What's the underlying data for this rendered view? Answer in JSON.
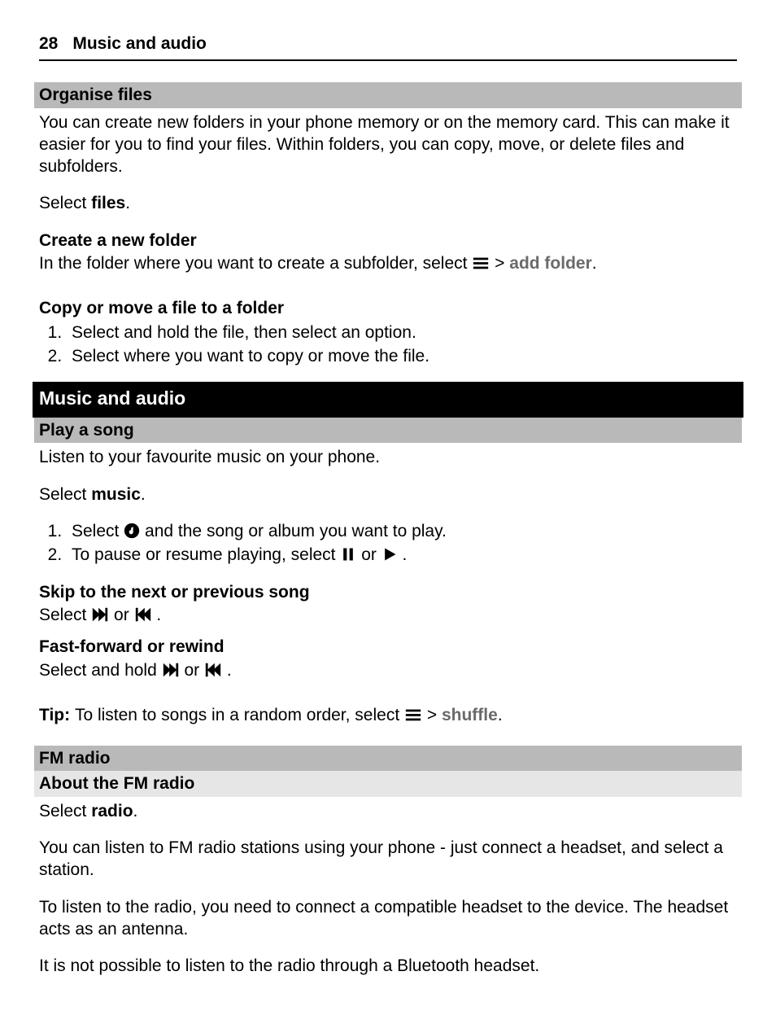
{
  "header": {
    "page_number": "28",
    "title": "Music and audio"
  },
  "sections": {
    "organise_files": {
      "heading": "Organise files",
      "p1": "You can create new folders in your phone memory or on the memory card. This can make it easier for you to find your files. Within folders, you can copy, move, or delete files and subfolders.",
      "select_prefix": "Select ",
      "select_word": "files",
      "select_suffix": "."
    },
    "create_folder": {
      "heading": "Create a new folder",
      "line_prefix": "In the folder where you want to create a subfolder, select ",
      "gt": " > ",
      "add_folder": "add folder",
      "suffix": "."
    },
    "copy_move": {
      "heading": "Copy or move a file to a folder",
      "steps": [
        "Select and hold the file, then select an option.",
        "Select where you want to copy or move the file."
      ]
    },
    "music_and_audio": "Music and audio",
    "play_song": {
      "heading": "Play a song",
      "p1": "Listen to your favourite music on your phone.",
      "select_prefix": "Select ",
      "select_word": "music",
      "select_suffix": ".",
      "step1_a": "Select ",
      "step1_b": " and the song or album you want to play.",
      "step2_a": "To pause or resume playing, select ",
      "step2_or": " or ",
      "step2_end": "."
    },
    "skip": {
      "heading": "Skip to the next or previous song",
      "prefix": "Select ",
      "or": " or ",
      "suffix": "."
    },
    "ff": {
      "heading": "Fast-forward or rewind",
      "prefix": "Select and hold ",
      "or": " or ",
      "suffix": "."
    },
    "tip": {
      "label": "Tip: ",
      "text": "To listen to songs in a random order, select ",
      "gt": " > ",
      "shuffle": "shuffle",
      "suffix": "."
    },
    "fm_radio": {
      "heading": "FM radio",
      "about": "About the FM radio",
      "select_prefix": "Select ",
      "select_word": "radio",
      "select_suffix": ".",
      "p1": "You can listen to FM radio stations using your phone - just connect a headset, and select a station.",
      "p2": "To listen to the radio, you need to connect a compatible headset to the device. The headset acts as an antenna.",
      "p3": "It is not possible to listen to the radio through a Bluetooth headset."
    }
  }
}
